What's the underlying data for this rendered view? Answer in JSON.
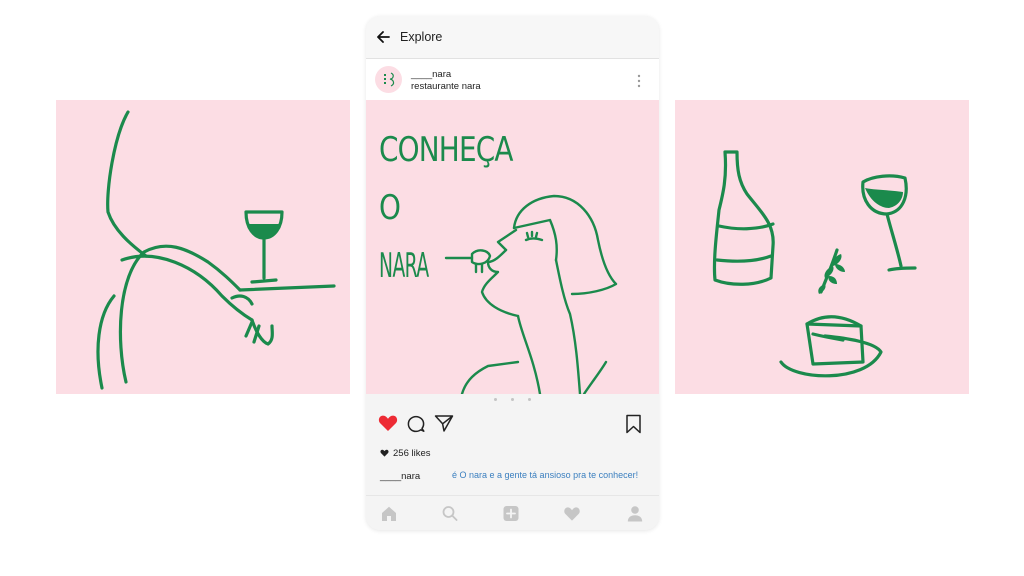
{
  "header": {
    "title": "Explore"
  },
  "post": {
    "username": "____nara",
    "fullname": "restaurante nara",
    "headline": [
      "CONHEÇA",
      "O",
      "NARA"
    ],
    "likes": "256 likes",
    "caption_user": "____nara",
    "caption": "é O nara e a gente tá ansioso pra te conhecer!"
  },
  "colors": {
    "panel_bg": "#fcdde4",
    "line_green": "#1b8a4c",
    "like_red": "#ed2b34",
    "caption_blue": "#3b7fbf"
  },
  "icons": {
    "top": [
      "back-arrow-icon",
      "more-options-icon"
    ],
    "actions": [
      "heart-icon",
      "comment-icon",
      "share-icon",
      "bookmark-icon"
    ],
    "nav": [
      "home-icon",
      "search-icon",
      "add-icon",
      "activity-icon",
      "profile-icon"
    ]
  }
}
